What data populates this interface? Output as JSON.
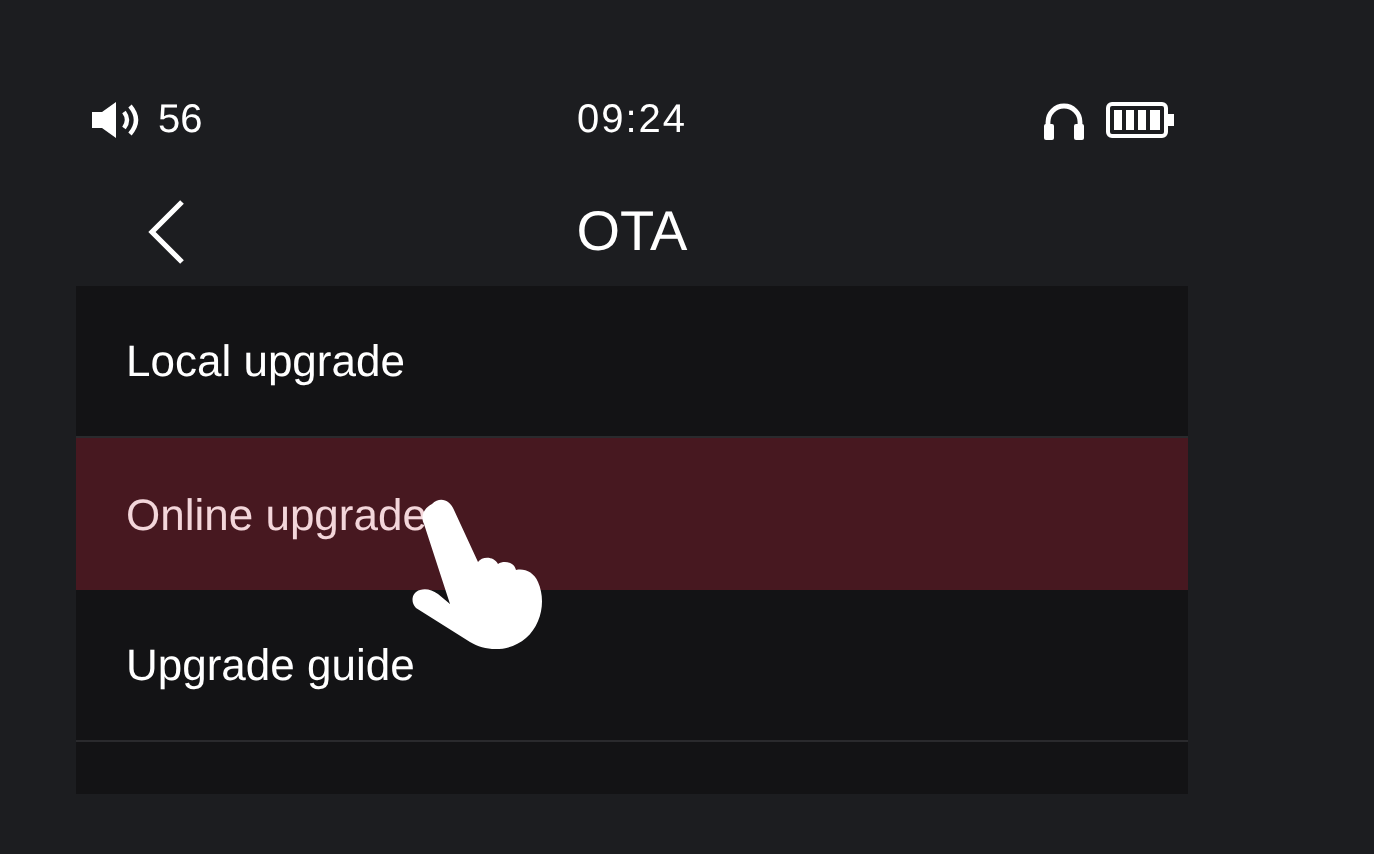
{
  "status_bar": {
    "volume": "56",
    "time": "09:24"
  },
  "header": {
    "title": "OTA"
  },
  "menu": [
    {
      "label": "Local upgrade",
      "selected": false
    },
    {
      "label": "Online upgrade",
      "selected": true
    },
    {
      "label": "Upgrade guide",
      "selected": false
    }
  ]
}
